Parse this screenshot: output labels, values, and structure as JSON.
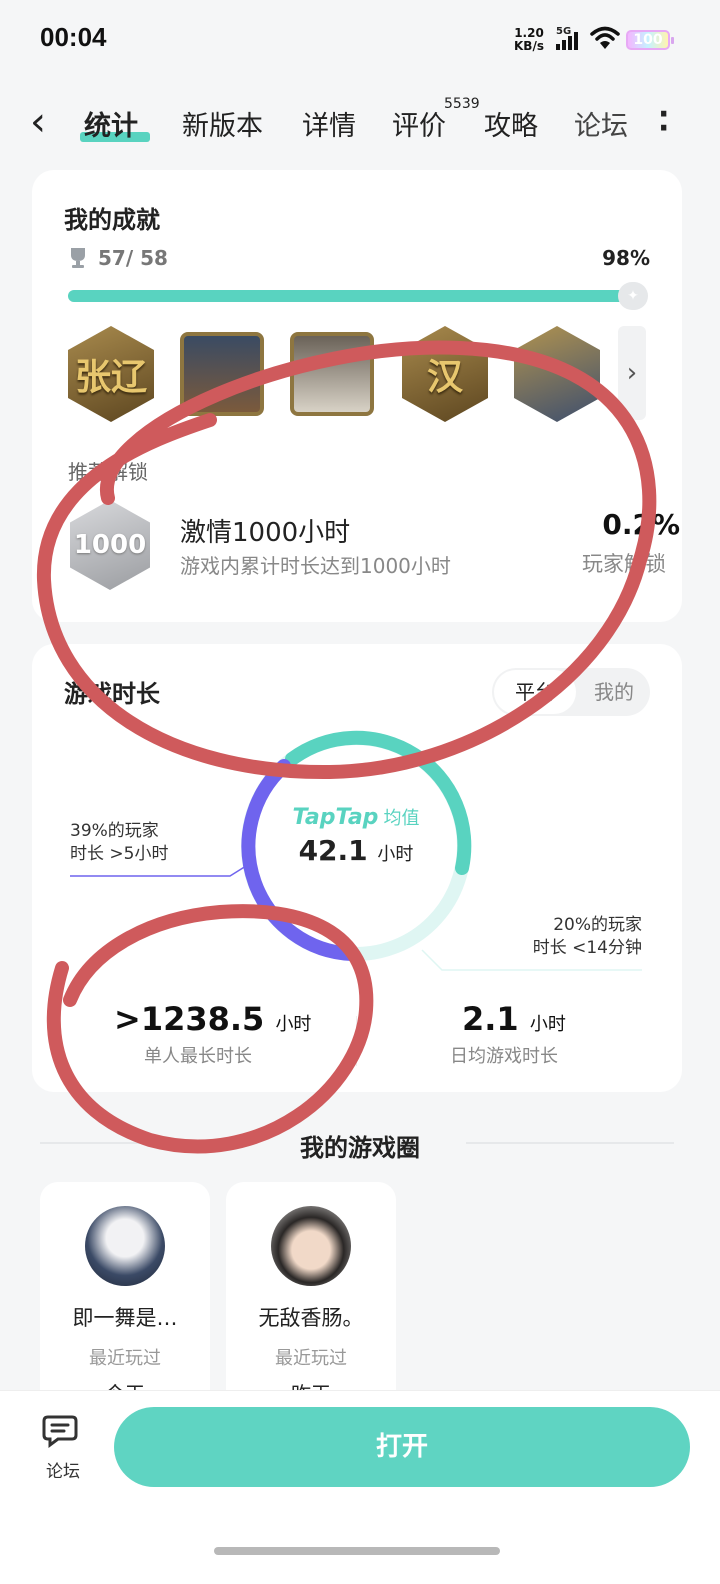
{
  "status_bar": {
    "time": "00:04",
    "net_speed_value": "1.20",
    "net_speed_unit": "KB/s",
    "network": "5G",
    "battery": "100"
  },
  "nav": {
    "back_icon": "chevron-left-icon",
    "tabs": [
      {
        "label": "统计",
        "active": true
      },
      {
        "label": "新版本",
        "active": false
      },
      {
        "label": "详情",
        "active": false
      },
      {
        "label": "评价",
        "active": false
      },
      {
        "label": "攻略",
        "active": false
      },
      {
        "label": "论坛",
        "active": false
      }
    ],
    "review_count": "5539",
    "more_icon": "more-vertical-icon"
  },
  "achievements": {
    "title": "我的成就",
    "count": "57/ 58",
    "percent": "98%",
    "progress": 0.98,
    "badges": [
      {
        "name": "badge-zhangliao",
        "text": "张辽"
      },
      {
        "name": "badge-general-portrait"
      },
      {
        "name": "badge-elder-portrait"
      },
      {
        "name": "badge-han",
        "text": "汉"
      },
      {
        "name": "badge-warrior-portrait"
      }
    ],
    "recommend_label": "推荐解锁",
    "recommend": {
      "medal_text": "1000",
      "name": "激情1000小时",
      "desc": "游戏内累计时长达到1000小时",
      "rate": "0.2%",
      "rate_label": "玩家解锁"
    }
  },
  "playtime": {
    "title": "游戏时长",
    "toggle": {
      "platform": "平台",
      "mine": "我的"
    },
    "brand": "TapTap",
    "avg_label": "均值",
    "avg_value": "42.1",
    "unit": "小时",
    "note_left_1": "39%的玩家",
    "note_left_2": "时长 >5小时",
    "note_right_1": "20%的玩家",
    "note_right_2": "时长 <14分钟",
    "max_value": ">1238.5",
    "max_label": "单人最长时长",
    "daily_value": "2.1",
    "daily_label": "日均游戏时长",
    "colors": {
      "long": "#6f64ee",
      "avg": "#59d3c0",
      "short": "#dff6f3"
    }
  },
  "circle": {
    "title": "我的游戏圈",
    "friends": [
      {
        "name": "即一舞是…",
        "sub": "最近玩过",
        "when": "今天"
      },
      {
        "name": "无敌香肠。",
        "sub": "最近玩过",
        "when": "昨天"
      }
    ]
  },
  "bottom": {
    "forum_label": "论坛",
    "open_label": "打开"
  }
}
